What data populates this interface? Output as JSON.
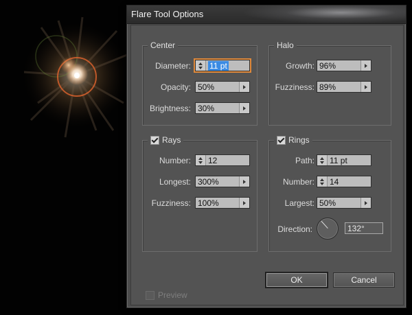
{
  "dialog": {
    "title": "Flare Tool Options"
  },
  "center": {
    "label": "Center",
    "diameter": {
      "label": "Diameter:",
      "value": "11 pt"
    },
    "opacity": {
      "label": "Opacity:",
      "value": "50%"
    },
    "brightness": {
      "label": "Brightness:",
      "value": "30%"
    }
  },
  "halo": {
    "label": "Halo",
    "growth": {
      "label": "Growth:",
      "value": "96%"
    },
    "fuzziness": {
      "label": "Fuzziness:",
      "value": "89%"
    }
  },
  "rays": {
    "label": "Rays",
    "checked": true,
    "number": {
      "label": "Number:",
      "value": "12"
    },
    "longest": {
      "label": "Longest:",
      "value": "300%"
    },
    "fuzziness": {
      "label": "Fuzziness:",
      "value": "100%"
    }
  },
  "rings": {
    "label": "Rings",
    "checked": true,
    "path": {
      "label": "Path:",
      "value": "11 pt"
    },
    "number": {
      "label": "Number:",
      "value": "14"
    },
    "largest": {
      "label": "Largest:",
      "value": "50%"
    },
    "direction": {
      "label": "Direction:",
      "value": "132°",
      "angle": 132
    }
  },
  "preview": {
    "label": "Preview",
    "checked": false,
    "enabled": false
  },
  "buttons": {
    "ok": "OK",
    "cancel": "Cancel"
  },
  "colors": {
    "accent_focus": "#e08a3c",
    "selection": "#3b8be3",
    "dialog_bg": "#535353"
  }
}
